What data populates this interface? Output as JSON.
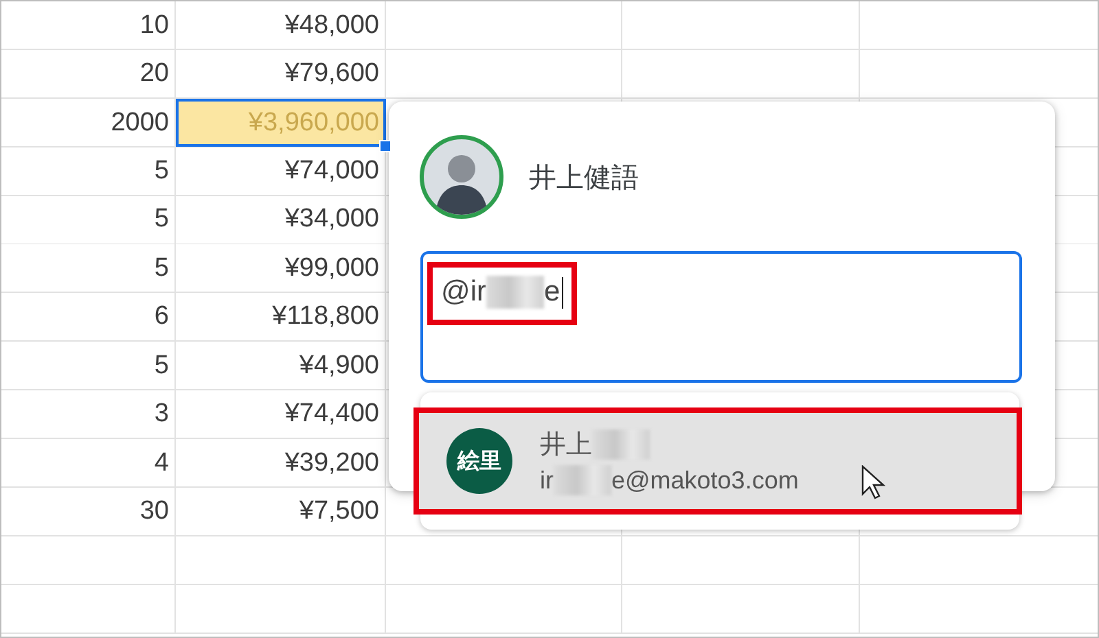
{
  "sheet": {
    "rows": [
      {
        "quantity": "10",
        "amount": "¥48,000",
        "selected": false
      },
      {
        "quantity": "20",
        "amount": "¥79,600",
        "selected": false
      },
      {
        "quantity": "2000",
        "amount": "¥3,960,000",
        "selected": true
      },
      {
        "quantity": "5",
        "amount": "¥74,000",
        "selected": false
      },
      {
        "quantity": "5",
        "amount": "¥34,000",
        "selected": false
      },
      {
        "quantity": "5",
        "amount": "¥99,000",
        "selected": false
      },
      {
        "quantity": "6",
        "amount": "¥118,800",
        "selected": false
      },
      {
        "quantity": "5",
        "amount": "¥4,900",
        "selected": false
      },
      {
        "quantity": "3",
        "amount": "¥74,400",
        "selected": false
      },
      {
        "quantity": "4",
        "amount": "¥39,200",
        "selected": false
      },
      {
        "quantity": "30",
        "amount": "¥7,500",
        "selected": false
      }
    ]
  },
  "comment": {
    "author": "井上健語",
    "input": {
      "highlighted": true,
      "segments": [
        {
          "kind": "text",
          "text": "@ir"
        },
        {
          "kind": "redacted"
        },
        {
          "kind": "text",
          "text": "e"
        }
      ]
    },
    "suggestions": [
      {
        "initials": "絵里",
        "highlighted": true,
        "selected": true,
        "name": [
          {
            "kind": "text",
            "text": "井上"
          },
          {
            "kind": "redacted"
          }
        ],
        "email": [
          {
            "kind": "text",
            "text": "ir"
          },
          {
            "kind": "redacted"
          },
          {
            "kind": "text",
            "text": "e@makoto3.com"
          }
        ]
      }
    ]
  }
}
